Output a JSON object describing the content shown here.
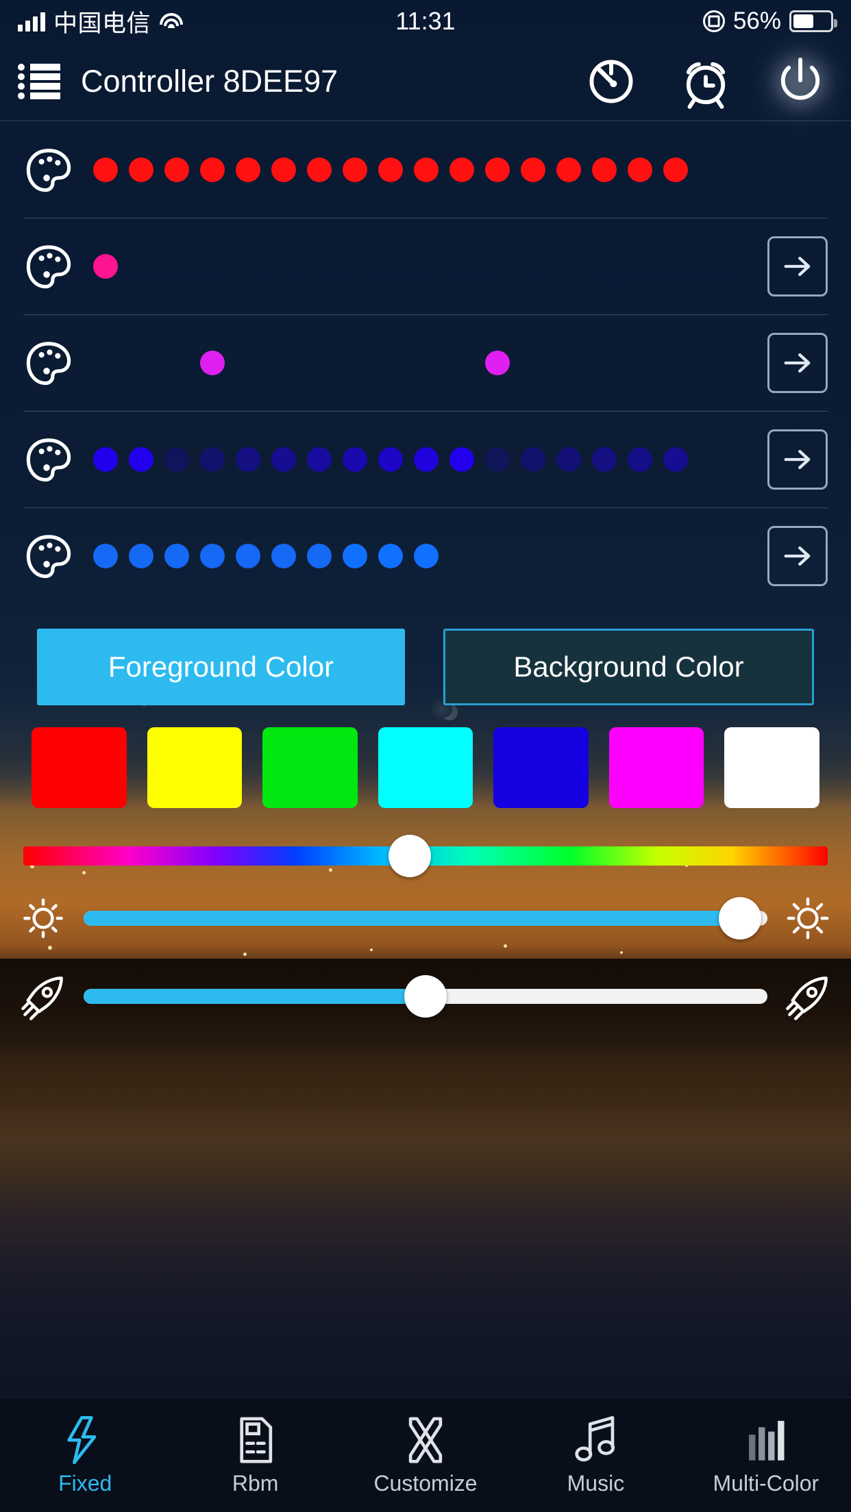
{
  "statusbar": {
    "carrier": "中国电信",
    "time": "11:31",
    "battery_percent": "56%",
    "signal_icon": "signal-bars-icon",
    "wifi_icon": "wifi-icon",
    "rotation_lock_icon": "rotation-lock-icon",
    "battery_icon": "battery-icon"
  },
  "header": {
    "menu_icon": "list-menu-icon",
    "title": "Controller 8DEE97",
    "timer_icon": "timer-icon",
    "alarm_icon": "alarm-clock-icon",
    "power_icon": "power-icon"
  },
  "pattern_rows": [
    {
      "name": "row-solid-red",
      "palette_icon": "palette-icon",
      "has_arrow": false,
      "arrow_icon": "arrow-right-icon",
      "dots": [
        {
          "color": "#ff1111",
          "opacity": 1
        },
        {
          "color": "#ff1111",
          "opacity": 1
        },
        {
          "color": "#ff1111",
          "opacity": 1
        },
        {
          "color": "#ff1111",
          "opacity": 1
        },
        {
          "color": "#ff1111",
          "opacity": 1
        },
        {
          "color": "#ff1111",
          "opacity": 1
        },
        {
          "color": "#ff1111",
          "opacity": 1
        },
        {
          "color": "#ff1111",
          "opacity": 1
        },
        {
          "color": "#ff1111",
          "opacity": 1
        },
        {
          "color": "#ff1111",
          "opacity": 1
        },
        {
          "color": "#ff1111",
          "opacity": 1
        },
        {
          "color": "#ff1111",
          "opacity": 1
        },
        {
          "color": "#ff1111",
          "opacity": 1
        },
        {
          "color": "#ff1111",
          "opacity": 1
        },
        {
          "color": "#ff1111",
          "opacity": 1
        },
        {
          "color": "#ff1111",
          "opacity": 1
        },
        {
          "color": "#ff1111",
          "opacity": 1
        }
      ]
    },
    {
      "name": "row-single-pink",
      "palette_icon": "palette-icon",
      "has_arrow": true,
      "arrow_icon": "arrow-right-icon",
      "dots": [
        {
          "color": "#ff1493",
          "opacity": 1
        },
        {
          "color": "transparent",
          "opacity": 0
        },
        {
          "color": "transparent",
          "opacity": 0
        },
        {
          "color": "transparent",
          "opacity": 0
        },
        {
          "color": "transparent",
          "opacity": 0
        },
        {
          "color": "transparent",
          "opacity": 0
        },
        {
          "color": "transparent",
          "opacity": 0
        },
        {
          "color": "transparent",
          "opacity": 0
        },
        {
          "color": "transparent",
          "opacity": 0
        },
        {
          "color": "transparent",
          "opacity": 0
        },
        {
          "color": "transparent",
          "opacity": 0
        },
        {
          "color": "transparent",
          "opacity": 0
        },
        {
          "color": "transparent",
          "opacity": 0
        },
        {
          "color": "transparent",
          "opacity": 0
        },
        {
          "color": "transparent",
          "opacity": 0
        },
        {
          "color": "transparent",
          "opacity": 0
        },
        {
          "color": "transparent",
          "opacity": 0
        }
      ]
    },
    {
      "name": "row-two-magenta",
      "palette_icon": "palette-icon",
      "has_arrow": true,
      "arrow_icon": "arrow-right-icon",
      "dots": [
        {
          "color": "transparent",
          "opacity": 0
        },
        {
          "color": "transparent",
          "opacity": 0
        },
        {
          "color": "transparent",
          "opacity": 0
        },
        {
          "color": "#e020f0",
          "opacity": 1
        },
        {
          "color": "transparent",
          "opacity": 0
        },
        {
          "color": "transparent",
          "opacity": 0
        },
        {
          "color": "transparent",
          "opacity": 0
        },
        {
          "color": "transparent",
          "opacity": 0
        },
        {
          "color": "transparent",
          "opacity": 0
        },
        {
          "color": "transparent",
          "opacity": 0
        },
        {
          "color": "transparent",
          "opacity": 0
        },
        {
          "color": "#e020f0",
          "opacity": 1
        },
        {
          "color": "transparent",
          "opacity": 0
        },
        {
          "color": "transparent",
          "opacity": 0
        },
        {
          "color": "transparent",
          "opacity": 0
        },
        {
          "color": "transparent",
          "opacity": 0
        },
        {
          "color": "transparent",
          "opacity": 0
        }
      ]
    },
    {
      "name": "row-fading-blue",
      "palette_icon": "palette-icon",
      "has_arrow": true,
      "arrow_icon": "arrow-right-icon",
      "dots": [
        {
          "color": "#2200ee",
          "opacity": 1
        },
        {
          "color": "#2200ee",
          "opacity": 1
        },
        {
          "color": "#2200ee",
          "opacity": 0.22
        },
        {
          "color": "#2200ee",
          "opacity": 0.3
        },
        {
          "color": "#2200ee",
          "opacity": 0.42
        },
        {
          "color": "#2200ee",
          "opacity": 0.5
        },
        {
          "color": "#2200ee",
          "opacity": 0.58
        },
        {
          "color": "#2200ee",
          "opacity": 0.66
        },
        {
          "color": "#2200ee",
          "opacity": 0.78
        },
        {
          "color": "#2200ee",
          "opacity": 0.9
        },
        {
          "color": "#2200ee",
          "opacity": 1
        },
        {
          "color": "#2200ee",
          "opacity": 0.2
        },
        {
          "color": "#2200ee",
          "opacity": 0.3
        },
        {
          "color": "#2200ee",
          "opacity": 0.36
        },
        {
          "color": "#2200ee",
          "opacity": 0.42
        },
        {
          "color": "#2200ee",
          "opacity": 0.46
        },
        {
          "color": "#2200ee",
          "opacity": 0.5
        }
      ]
    },
    {
      "name": "row-ten-blue",
      "palette_icon": "palette-icon",
      "has_arrow": true,
      "arrow_icon": "arrow-right-icon",
      "dots": [
        {
          "color": "#1569f5",
          "opacity": 1
        },
        {
          "color": "#1569f5",
          "opacity": 1
        },
        {
          "color": "#1569f5",
          "opacity": 1
        },
        {
          "color": "#1569f5",
          "opacity": 1
        },
        {
          "color": "#1569f5",
          "opacity": 1
        },
        {
          "color": "#1569f5",
          "opacity": 1
        },
        {
          "color": "#1569f5",
          "opacity": 1
        },
        {
          "color": "#1070ff",
          "opacity": 1
        },
        {
          "color": "#1070ff",
          "opacity": 1
        },
        {
          "color": "#1070ff",
          "opacity": 1
        },
        {
          "color": "transparent",
          "opacity": 0
        },
        {
          "color": "transparent",
          "opacity": 0
        },
        {
          "color": "transparent",
          "opacity": 0
        },
        {
          "color": "transparent",
          "opacity": 0
        },
        {
          "color": "transparent",
          "opacity": 0
        },
        {
          "color": "transparent",
          "opacity": 0
        },
        {
          "color": "transparent",
          "opacity": 0
        }
      ]
    }
  ],
  "color_target": {
    "foreground_label": "Foreground Color",
    "background_label": "Background Color",
    "selected": "foreground",
    "active_color": "#2dbbef",
    "inactive_border_color": "#2a9fd4"
  },
  "swatches": [
    {
      "name": "swatch-red",
      "color": "#ff0000"
    },
    {
      "name": "swatch-yellow",
      "color": "#ffff00"
    },
    {
      "name": "swatch-green",
      "color": "#00e810"
    },
    {
      "name": "swatch-cyan",
      "color": "#00ffff"
    },
    {
      "name": "swatch-blue",
      "color": "#1400e0"
    },
    {
      "name": "swatch-magenta",
      "color": "#ff00ff"
    },
    {
      "name": "swatch-white",
      "color": "#ffffff"
    }
  ],
  "hue_slider": {
    "name": "hue-slider",
    "value_percent": 48
  },
  "brightness_slider": {
    "name": "brightness-slider",
    "left_icon": "brightness-low-icon",
    "right_icon": "brightness-high-icon",
    "value_percent": 96,
    "fill_color": "#2dbbef"
  },
  "speed_slider": {
    "name": "speed-slider",
    "left_icon": "rocket-icon",
    "right_icon": "rocket-icon",
    "value_percent": 50,
    "fill_color": "#2dbbef"
  },
  "tabs": [
    {
      "label": "Fixed",
      "icon": "lightning-bolt-icon",
      "active": true
    },
    {
      "label": "Rbm",
      "icon": "document-icon",
      "active": false
    },
    {
      "label": "Customize",
      "icon": "crossed-ribbons-icon",
      "active": false
    },
    {
      "label": "Music",
      "icon": "music-note-icon",
      "active": false
    },
    {
      "label": "Multi-Color",
      "icon": "equalizer-bars-icon",
      "active": false
    }
  ],
  "theme": {
    "accent": "#2dbbef",
    "panel_bg": "#0b1b34",
    "tabbar_bg": "#090e1a"
  }
}
